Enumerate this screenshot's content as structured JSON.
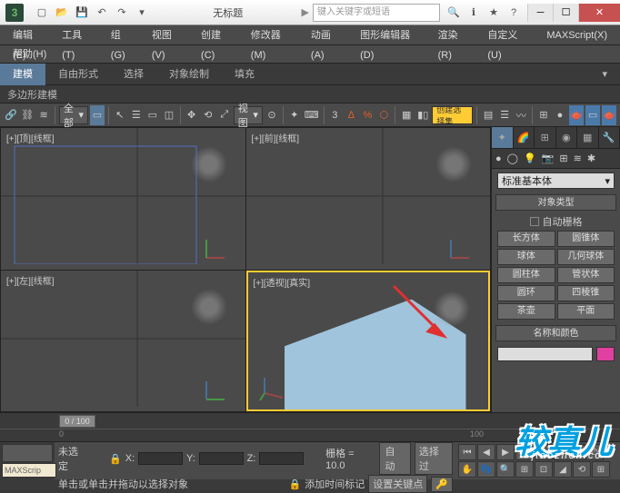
{
  "titlebar": {
    "title": "无标题",
    "search_placeholder": "键入关键字或短语"
  },
  "menus": {
    "row1": [
      "编辑(E)",
      "工具(T)",
      "组(G)",
      "视图(V)",
      "创建(C)",
      "修改器(M)",
      "动画(A)",
      "图形编辑器(D)",
      "渲染(R)",
      "自定义(U)",
      "MAXScript(X)"
    ],
    "row2": [
      "帮助(H)"
    ]
  },
  "ribbon": {
    "tabs": [
      "建模",
      "自由形式",
      "选择",
      "对象绘制",
      "填充"
    ],
    "sub": "多边形建模"
  },
  "toolbar": {
    "dd1": "全部",
    "dd2": "视图",
    "dd3": "创建选择集"
  },
  "viewports": {
    "vp1": "[+][顶][线框]",
    "vp2": "[+][前][线框]",
    "vp3": "[+][左][线框]",
    "vp4": "[+][透视][真实]"
  },
  "panel": {
    "dropdown": "标准基本体",
    "rollout1": "对象类型",
    "autogrid": "自动栅格",
    "buttons": [
      [
        "长方体",
        "圆锥体"
      ],
      [
        "球体",
        "几何球体"
      ],
      [
        "圆柱体",
        "管状体"
      ],
      [
        "圆环",
        "四棱锥"
      ],
      [
        "茶壶",
        "平面"
      ]
    ],
    "rollout2": "名称和颜色"
  },
  "timeline": {
    "slider": "0 / 100"
  },
  "status": {
    "none_selected": "未选定",
    "x": "X:",
    "y": "Y:",
    "z": "Z:",
    "grid": "栅格 = 10.0",
    "auto": "自动",
    "filter": "选择过",
    "script": "MAXScrip",
    "hint": "单击或单击并拖动以选择对象",
    "addkey": "添加时间标记",
    "setkey": "设置关键点"
  },
  "watermark": {
    "main": "较真儿",
    "sub": "jiaozhen.cc"
  }
}
